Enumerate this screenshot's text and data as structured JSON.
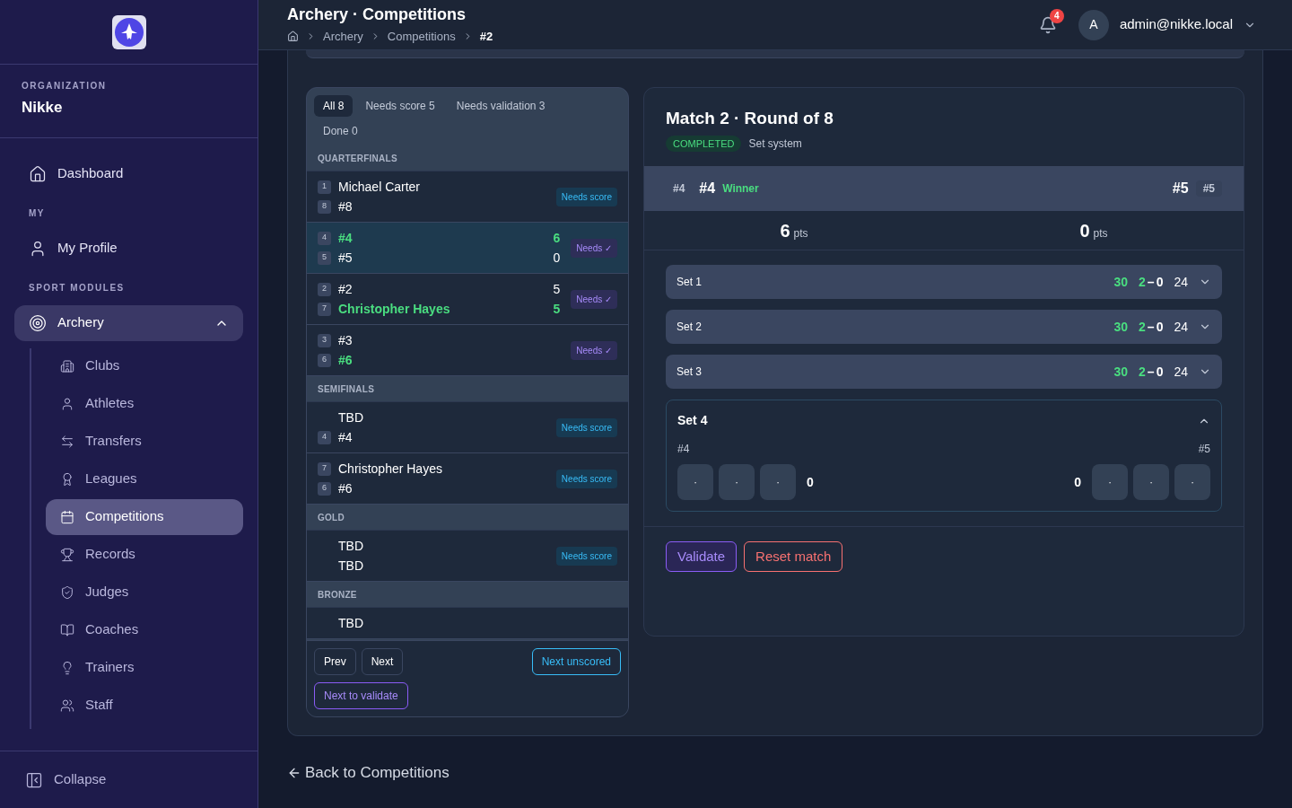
{
  "sidebar": {
    "org_label": "ORGANIZATION",
    "org_name": "Nikke",
    "sections": [
      {
        "items": [
          {
            "label": "Dashboard",
            "selected": false
          }
        ]
      },
      {
        "title": "MY",
        "items": [
          {
            "label": "My Profile",
            "selected": false
          }
        ]
      },
      {
        "title": "SPORT MODULES",
        "items": [
          {
            "label": "Archery",
            "selected": false,
            "expanded": true,
            "children": [
              {
                "label": "Clubs",
                "selected": false
              },
              {
                "label": "Athletes",
                "selected": false
              },
              {
                "label": "Transfers",
                "selected": false
              },
              {
                "label": "Leagues",
                "selected": false
              },
              {
                "label": "Competitions",
                "selected": true
              },
              {
                "label": "Records",
                "selected": false
              },
              {
                "label": "Judges",
                "selected": false
              },
              {
                "label": "Coaches",
                "selected": false
              },
              {
                "label": "Trainers",
                "selected": false
              },
              {
                "label": "Staff",
                "selected": false
              }
            ]
          }
        ]
      }
    ],
    "collapse": "Collapse"
  },
  "header": {
    "title": "Archery · Competitions",
    "breadcrumb": [
      "Archery",
      "Competitions",
      "#2"
    ],
    "notifications": "4",
    "avatar": "A",
    "user": "admin@nikke.local"
  },
  "filters": [
    {
      "label": "All",
      "count": "8",
      "selected": true
    },
    {
      "label": "Needs score",
      "count": "5",
      "selected": false
    },
    {
      "label": "Needs validation",
      "count": "3",
      "selected": false
    },
    {
      "label": "Done",
      "count": "0",
      "selected": false
    }
  ],
  "rounds": [
    {
      "title": "QUARTERFINALS",
      "matches": [
        {
          "selected": false,
          "status": {
            "kind": "score",
            "text": "Needs score"
          },
          "players": [
            {
              "seed": "1",
              "name": "Michael Carter",
              "winner": false
            },
            {
              "seed": "8",
              "name": "#8",
              "winner": false
            }
          ]
        },
        {
          "selected": true,
          "status": {
            "kind": "validate",
            "text": "Needs ✓"
          },
          "players": [
            {
              "seed": "4",
              "name": "#4",
              "winner": true,
              "score": "6"
            },
            {
              "seed": "5",
              "name": "#5",
              "winner": false,
              "score": "0"
            }
          ]
        },
        {
          "selected": false,
          "status": {
            "kind": "validate",
            "text": "Needs ✓"
          },
          "players": [
            {
              "seed": "2",
              "name": "#2",
              "winner": false,
              "score": "5"
            },
            {
              "seed": "7",
              "name": "Christopher Hayes",
              "winner": true,
              "score": "5"
            }
          ]
        },
        {
          "selected": false,
          "status": {
            "kind": "validate",
            "text": "Needs ✓"
          },
          "players": [
            {
              "seed": "3",
              "name": "#3",
              "winner": false
            },
            {
              "seed": "6",
              "name": "#6",
              "winner": true
            }
          ]
        }
      ]
    },
    {
      "title": "SEMIFINALS",
      "matches": [
        {
          "selected": false,
          "status": {
            "kind": "score",
            "text": "Needs score"
          },
          "players": [
            {
              "name": "TBD",
              "winner": false
            },
            {
              "seed": "4",
              "name": "#4",
              "winner": false
            }
          ]
        },
        {
          "selected": false,
          "status": {
            "kind": "score",
            "text": "Needs score"
          },
          "players": [
            {
              "seed": "7",
              "name": "Christopher Hayes",
              "winner": false
            },
            {
              "seed": "6",
              "name": "#6",
              "winner": false
            }
          ]
        }
      ]
    },
    {
      "title": "GOLD",
      "matches": [
        {
          "selected": false,
          "status": {
            "kind": "score",
            "text": "Needs score"
          },
          "players": [
            {
              "name": "TBD",
              "winner": false
            },
            {
              "name": "TBD",
              "winner": false
            }
          ]
        }
      ]
    },
    {
      "title": "BRONZE",
      "matches": [
        {
          "selected": false,
          "players": [
            {
              "name": "TBD",
              "winner": false
            }
          ]
        }
      ]
    }
  ],
  "list_buttons": {
    "prev": "Prev",
    "next": "Next",
    "next_unscored": "Next unscored",
    "next_validate": "Next to validate"
  },
  "match": {
    "title": "Match 2 · Round of 8",
    "status": "COMPLETED",
    "system": "Set system",
    "left": {
      "badge": "#4",
      "name": "#4",
      "tag": "Winner",
      "points": "6",
      "unit": "pts"
    },
    "right": {
      "badge": "#5",
      "name": "#5",
      "points": "0",
      "unit": "pts"
    },
    "sets": [
      {
        "kind": "collapsed",
        "label": "Set 1",
        "left_score": "30",
        "left_points": "2",
        "dash": "–",
        "right_points": "0",
        "right_score": "24",
        "left_won": true,
        "right_won": false
      },
      {
        "kind": "collapsed",
        "label": "Set 2",
        "left_score": "30",
        "left_points": "2",
        "dash": "–",
        "right_points": "0",
        "right_score": "24",
        "left_won": true,
        "right_won": false
      },
      {
        "kind": "collapsed",
        "label": "Set 3",
        "left_score": "30",
        "left_points": "2",
        "dash": "–",
        "right_points": "0",
        "right_score": "24",
        "left_won": true,
        "right_won": false
      },
      {
        "kind": "expanded",
        "label": "Set 4",
        "left_name": "#4",
        "right_name": "#5",
        "left_arrows": [
          "·",
          "·",
          "·"
        ],
        "right_arrows": [
          "·",
          "·",
          "·"
        ],
        "left_total": "0",
        "right_total": "0"
      }
    ],
    "actions": {
      "validate": "Validate",
      "reset": "Reset match"
    }
  },
  "back": "Back to Competitions"
}
